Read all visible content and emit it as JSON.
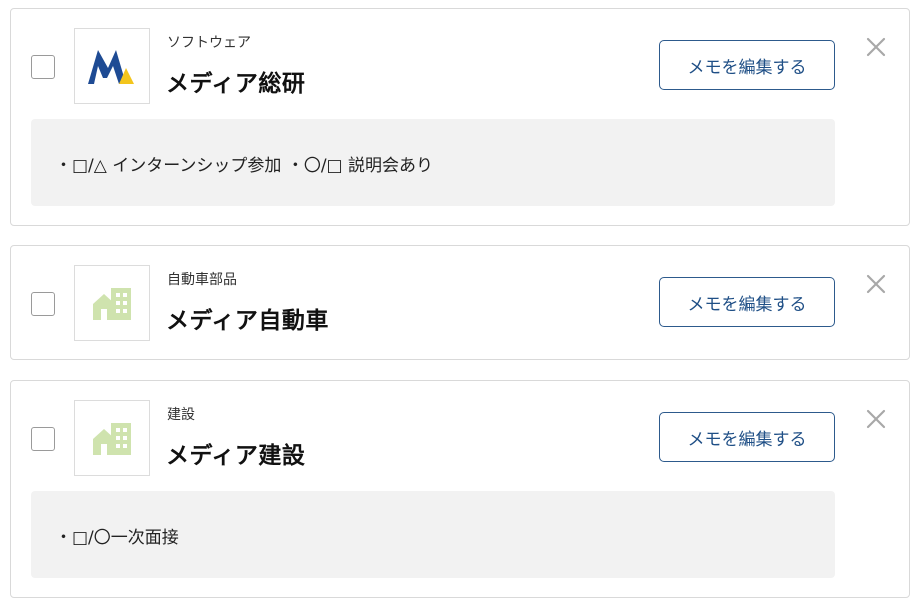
{
  "cards": [
    {
      "industry": "ソフトウェア",
      "company": "メディア総研",
      "logo_icon": "media-souken-logo-icon",
      "memo_button_label": "メモを編集する",
      "memo": "・□/△ インターンシップ参加 ・〇/□ 説明会あり"
    },
    {
      "industry": "自動車部品",
      "company": "メディア自動車",
      "logo_icon": "building-placeholder-icon",
      "memo_button_label": "メモを編集する"
    },
    {
      "industry": "建設",
      "company": "メディア建設",
      "logo_icon": "building-placeholder-icon",
      "memo_button_label": "メモを編集する",
      "memo": "・□/〇一次面接"
    }
  ],
  "colors": {
    "button_border": "#2d5a8c",
    "button_text": "#1f4f86",
    "memo_background": "#f2f2f2",
    "placeholder_icon": "#cfe3ae",
    "logo_blue": "#1e4b94",
    "logo_yellow": "#f3c51c"
  }
}
